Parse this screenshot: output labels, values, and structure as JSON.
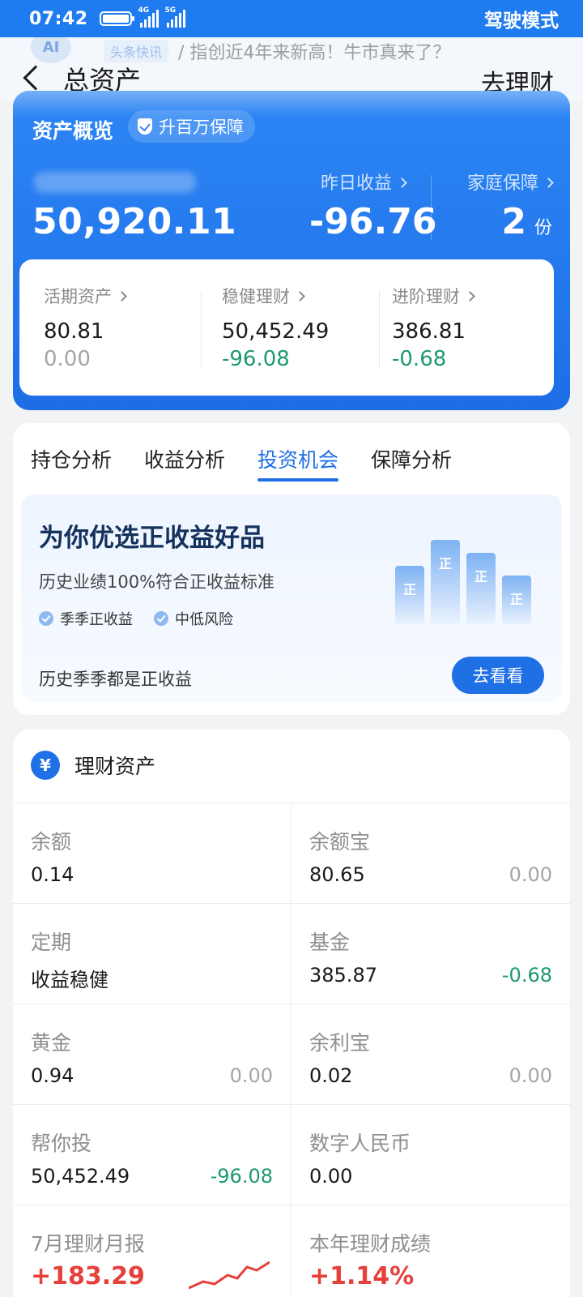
{
  "status_bar": {
    "time": "07:42",
    "net1": "4G",
    "net2": "5G",
    "driving_mode": "驾驶模式"
  },
  "header": {
    "ticker_chip": "头条快讯",
    "ticker_text": "/ 指创近4年来新高！牛市真来了？",
    "title": "总资产",
    "go_invest": "去理财"
  },
  "overview": {
    "title": "资产概览",
    "badge": "升百万保障",
    "total": "50,920.11",
    "yesterday_label": "昨日收益",
    "yesterday_value": "-96.76",
    "family_label": "家庭保障",
    "family_value": "2",
    "family_unit": "份",
    "columns": [
      {
        "label": "活期资产",
        "amount": "80.81",
        "change": "0.00"
      },
      {
        "label": "稳健理财",
        "amount": "50,452.49",
        "change": "-96.08"
      },
      {
        "label": "进阶理财",
        "amount": "386.81",
        "change": "-0.68"
      }
    ]
  },
  "tabs": [
    "持仓分析",
    "收益分析",
    "投资机会",
    "保障分析"
  ],
  "active_tab": "投资机会",
  "opportunity": {
    "title": "为你优选正收益好品",
    "subtitle": "历史业绩100%符合正收益标准",
    "tags": [
      "季季正收益",
      "中低风险"
    ],
    "footer": "历史季季都是正收益",
    "button": "去看看",
    "bar_char": "正"
  },
  "assets": {
    "title": "理财资产",
    "rows": [
      [
        {
          "name": "余额",
          "amount": "0.14",
          "change": ""
        },
        {
          "name": "余额宝",
          "amount": "80.65",
          "change": "0.00"
        }
      ],
      [
        {
          "name": "定期",
          "amount": "收益稳健",
          "change": ""
        },
        {
          "name": "基金",
          "amount": "385.87",
          "change": "-0.68"
        }
      ],
      [
        {
          "name": "黄金",
          "amount": "0.94",
          "change": "0.00"
        },
        {
          "name": "余利宝",
          "amount": "0.02",
          "change": "0.00"
        }
      ],
      [
        {
          "name": "帮你投",
          "amount": "50,452.49",
          "change": "-96.08"
        },
        {
          "name": "数字人民币",
          "amount": "0.00",
          "change": ""
        }
      ]
    ],
    "reports": [
      {
        "name": "7月理财月报",
        "value": "+183.29"
      },
      {
        "name": "本年理财成绩",
        "value": "+1.14%"
      }
    ]
  },
  "colors": {
    "brand_blue": "#1f6fe5",
    "negative_green": "#1d9a6c",
    "positive_red": "#e5403a"
  }
}
